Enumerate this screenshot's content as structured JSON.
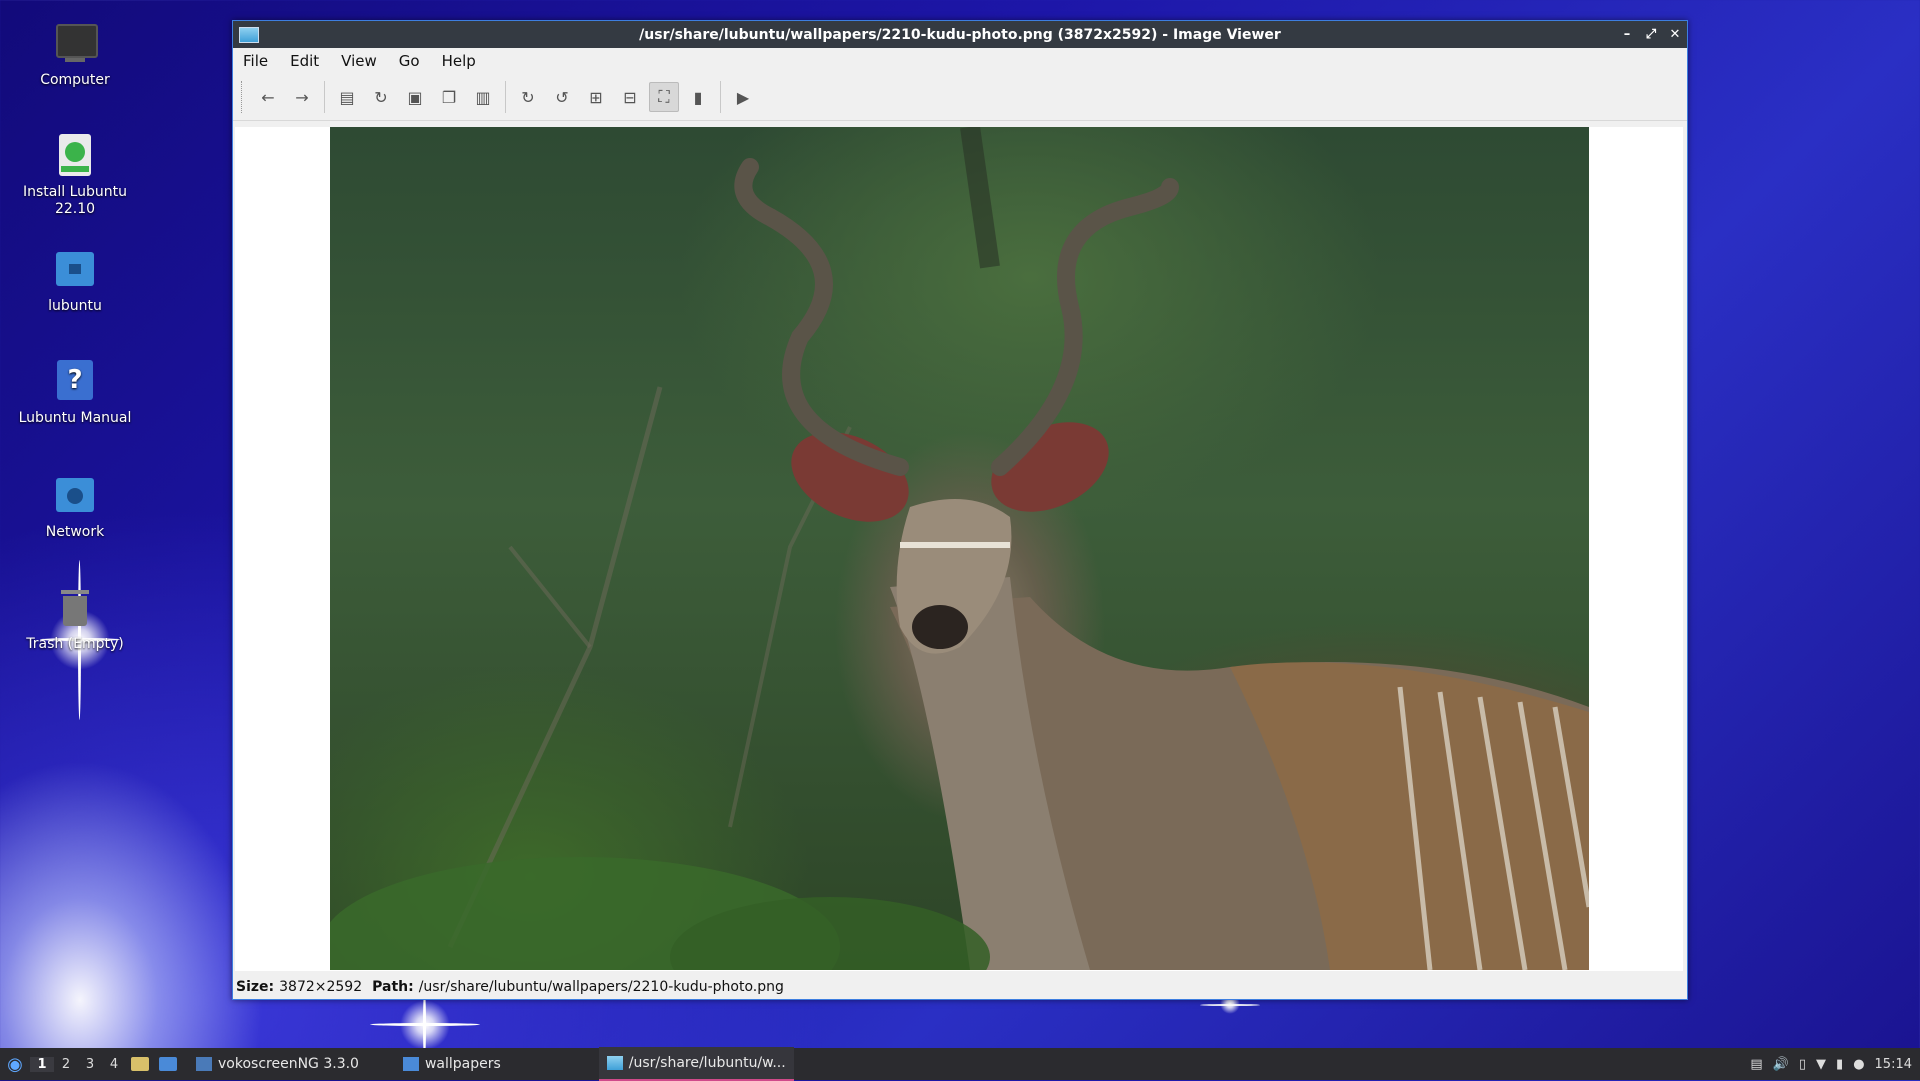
{
  "desktop": {
    "icons": [
      {
        "label": "Computer"
      },
      {
        "label": "Install Lubuntu 22.10"
      },
      {
        "label": "lubuntu"
      },
      {
        "label": "Lubuntu Manual"
      },
      {
        "label": "Network"
      },
      {
        "label": "Trash (Empty)"
      }
    ]
  },
  "window": {
    "title": "/usr/share/lubuntu/wallpapers/2210-kudu-photo.png (3872x2592) - Image Viewer",
    "controls": {
      "minimize": "–",
      "maximize": "⤢",
      "close": "✕"
    },
    "menu": [
      "File",
      "Edit",
      "View",
      "Go",
      "Help"
    ],
    "toolbar": {
      "icons": [
        "back-icon",
        "forward-icon",
        "open-icon",
        "reload-icon",
        "save-icon",
        "copy-icon",
        "paste-icon",
        "rotate-cw-icon",
        "rotate-ccw-icon",
        "zoom-in-icon",
        "zoom-out-icon",
        "fit-icon",
        "original-size-icon",
        "slideshow-icon"
      ],
      "glyphs": {
        "back": "←",
        "forward": "→",
        "open": "▤",
        "reload": "↻",
        "save": "▣",
        "copy": "❐",
        "paste": "▥",
        "rotate_cw": "↻",
        "rotate_ccw": "↺",
        "zoom_in": "⊞",
        "zoom_out": "⊟",
        "fit": "⛶",
        "original": "▮",
        "slideshow": "▶"
      }
    },
    "status": {
      "size_label": "Size:",
      "size_value": "3872×2592",
      "path_label": "Path:",
      "path_value": "/usr/share/lubuntu/wallpapers/2210-kudu-photo.png"
    }
  },
  "taskbar": {
    "workspaces": [
      "1",
      "2",
      "3",
      "4"
    ],
    "tasks": [
      {
        "label": "vokoscreenNG 3.3.0"
      },
      {
        "label": "wallpapers"
      },
      {
        "label": "/usr/share/lubuntu/w..."
      }
    ],
    "clock": "15:14"
  },
  "colors": {
    "desktop_bg": "#1d16a8",
    "titlebar": "#343a42",
    "taskbar": "#2b2b2f",
    "active_task_underline": "#d04a8a"
  }
}
